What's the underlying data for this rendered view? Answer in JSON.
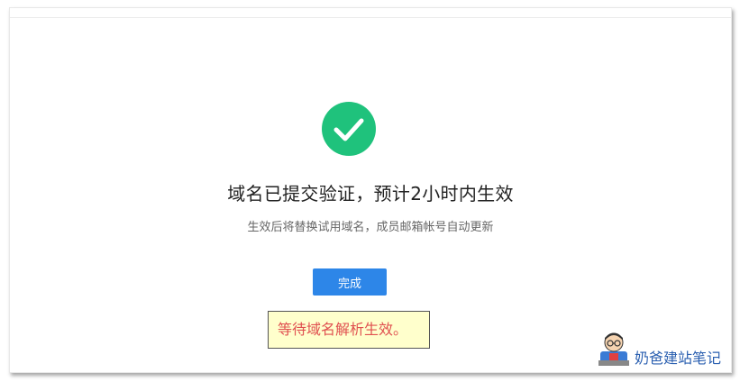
{
  "result": {
    "icon": "check-circle-icon",
    "icon_color": "#1fc27c",
    "title": "域名已提交验证，预计2小时内生效",
    "subtitle": "生效后将替换试用域名，成员邮箱帐号自动更新",
    "done_label": "完成",
    "button_color": "#2d86e8"
  },
  "annotation": {
    "note": "等待域名解析生效。"
  },
  "watermark": {
    "icon": "mascot-icon",
    "text": "奶爸建站笔记"
  }
}
